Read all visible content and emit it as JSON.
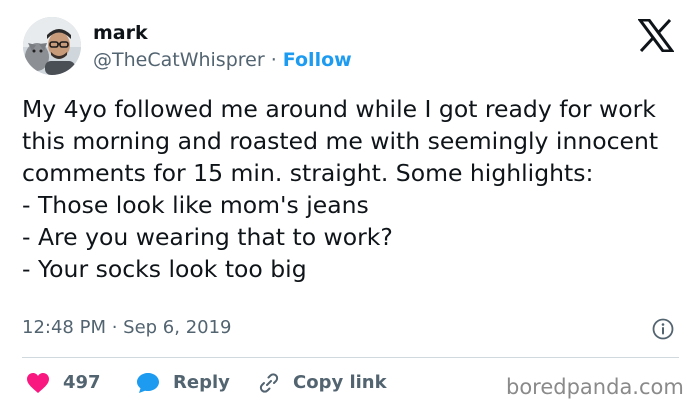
{
  "author": {
    "name": "mark",
    "handle": "@TheCatWhisprer",
    "separator": " · ",
    "follow_label": "Follow"
  },
  "tweet": {
    "text": "My 4yo followed me around while I got ready for work this morning and roasted me with seemingly innocent comments for 15 min. straight. Some highlights:\n- Those look like mom's jeans\n- Are you wearing that to work?\n- Your socks look too big",
    "timestamp": "12:48 PM · Sep 6, 2019"
  },
  "actions": {
    "likes": "497",
    "reply_label": "Reply",
    "copy_label": "Copy link"
  },
  "watermark": "boredpanda.com",
  "icons": {
    "logo": "x-logo-icon",
    "info": "info-icon",
    "like": "heart-icon",
    "reply": "speech-bubble-icon",
    "copy": "link-icon"
  },
  "colors": {
    "text": "#0f1419",
    "secondary": "#536471",
    "follow": "#1d9bf0",
    "heart": "#f91880",
    "reply_icon": "#1d9bf0"
  }
}
